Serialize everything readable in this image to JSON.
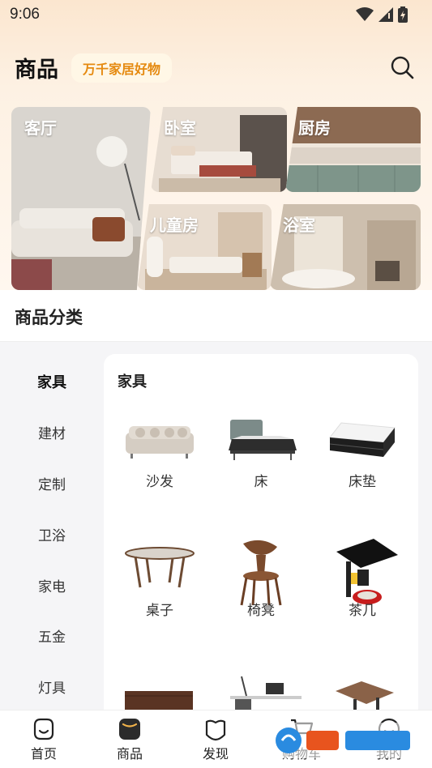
{
  "status": {
    "time": "9:06"
  },
  "header": {
    "title": "商品",
    "badge": "万千家居好物"
  },
  "rooms": [
    {
      "label": "客厅"
    },
    {
      "label": "卧室"
    },
    {
      "label": "厨房"
    },
    {
      "label": "儿童房"
    },
    {
      "label": "浴室"
    }
  ],
  "category": {
    "title": "商品分类",
    "sidebar": [
      "家具",
      "建材",
      "定制",
      "卫浴",
      "家电",
      "五金",
      "灯具"
    ],
    "panel_title": "家具",
    "products": [
      {
        "name": "沙发",
        "icon": "sofa-icon"
      },
      {
        "name": "床",
        "icon": "bed-icon"
      },
      {
        "name": "床垫",
        "icon": "mattress-icon"
      },
      {
        "name": "桌子",
        "icon": "table-icon"
      },
      {
        "name": "椅凳",
        "icon": "chair-icon"
      },
      {
        "name": "茶几",
        "icon": "tea-table-icon"
      }
    ]
  },
  "tabbar": {
    "items": [
      {
        "label": "首页"
      },
      {
        "label": "商品"
      },
      {
        "label": "发现"
      },
      {
        "label": "购物车"
      },
      {
        "label": "我的"
      }
    ]
  },
  "colors": {
    "accent": "#e58a10",
    "badge_bg": "#fff7e6",
    "header_gradient_top": "#fbe6cf"
  }
}
